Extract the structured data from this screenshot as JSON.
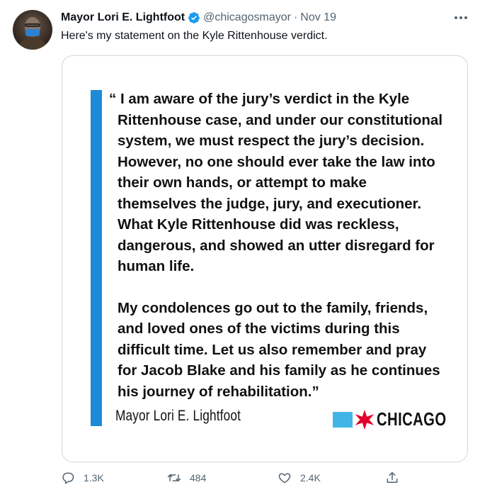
{
  "tweet": {
    "author_name": "Mayor Lori E. Lightfoot",
    "handle": "@chicagosmayor",
    "separator": "·",
    "time": "Nov 19",
    "text": "Here's my statement on the Kyle Rittenhouse verdict."
  },
  "card": {
    "paragraph1": "“ I am aware of the jury’s verdict in the Kyle Rittenhouse case, and under our constitutional system, we must respect the jury’s decision. However, no one should ever take the law into their own hands, or attempt to make themselves the judge, jury, and executioner. What Kyle Rittenhouse did was reckless, dangerous, and showed an utter disregard for human life.",
    "paragraph2": "My condolences go out to the family, friends, and loved ones of the victims during this difficult time. Let us also remember and pray for Jacob Blake and his family as he continues his journey of rehabilitation.”",
    "signature": "Mayor Lori E. Lightfoot",
    "logo_text": "CHICAGO",
    "accent_color": "#1d8bd8",
    "logo_square_color": "#41b6e6",
    "logo_star_color": "#e4002b"
  },
  "actions": {
    "reply_count": "1.3K",
    "retweet_count": "484",
    "like_count": "2.4K"
  },
  "icons": [
    "verified-badge-icon",
    "more-icon",
    "reply-icon",
    "retweet-icon",
    "like-icon",
    "share-icon",
    "chicago-star-icon"
  ]
}
